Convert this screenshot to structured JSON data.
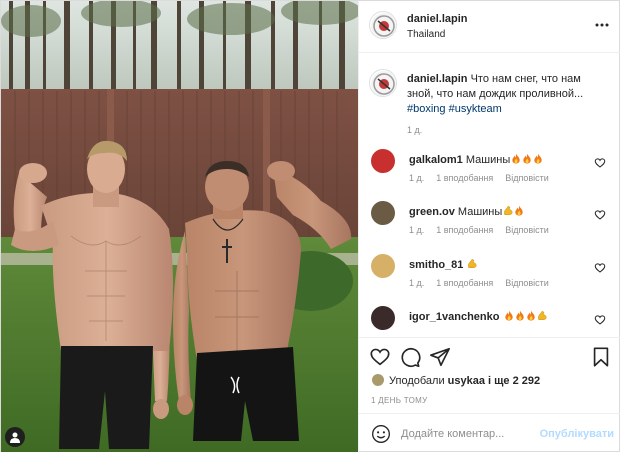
{
  "post": {
    "username": "daniel.lapin",
    "location": "Thailand",
    "more_icon": "more-horizontal-icon",
    "caption": {
      "username": "daniel.lapin",
      "text": "Что нам снег, что нам зной, что нам дождик проливной...",
      "hashtags": [
        "#boxing",
        "#usykteam"
      ],
      "age": "1 д."
    }
  },
  "comments": [
    {
      "username": "galkalom1",
      "text": "Машины",
      "emoji": [
        "fire",
        "fire",
        "fire"
      ],
      "age": "1 д.",
      "likes": "1 вподобання",
      "reply": "Відповісти",
      "avatar_color": "#c83030"
    },
    {
      "username": "green.ov",
      "text": "Машины",
      "emoji": [
        "flex",
        "fire"
      ],
      "age": "1 д.",
      "likes": "1 вподобання",
      "reply": "Відповісти",
      "avatar_color": "#6b5a44"
    },
    {
      "username": "smitho_81",
      "text": "",
      "emoji": [
        "flex"
      ],
      "age": "1 д.",
      "likes": "1 вподобання",
      "reply": "Відповісти",
      "avatar_color": "#d7b068"
    },
    {
      "username": "igor_1vanchenko",
      "text": "",
      "emoji": [
        "fire",
        "fire",
        "fire",
        "flex"
      ],
      "age": "",
      "likes": "",
      "reply": "",
      "avatar_color": "#3a2a2a"
    }
  ],
  "actions": {
    "like_icon": "heart-icon",
    "comment_icon": "comment-icon",
    "share_icon": "share-icon",
    "save_icon": "bookmark-icon"
  },
  "likes": {
    "prefix": "Уподобали",
    "user": "usykaa",
    "suffix": "і ще 2 292"
  },
  "posted": "1 ДЕНЬ ТОМУ",
  "add_comment": {
    "placeholder": "Додайте коментар...",
    "publish": "Опублікувати",
    "emoji_icon": "smile-icon"
  },
  "colors": {
    "link": "#00376b",
    "muted": "#8e8e8e",
    "publish_disabled": "#b3dbff",
    "border": "#efefef"
  }
}
